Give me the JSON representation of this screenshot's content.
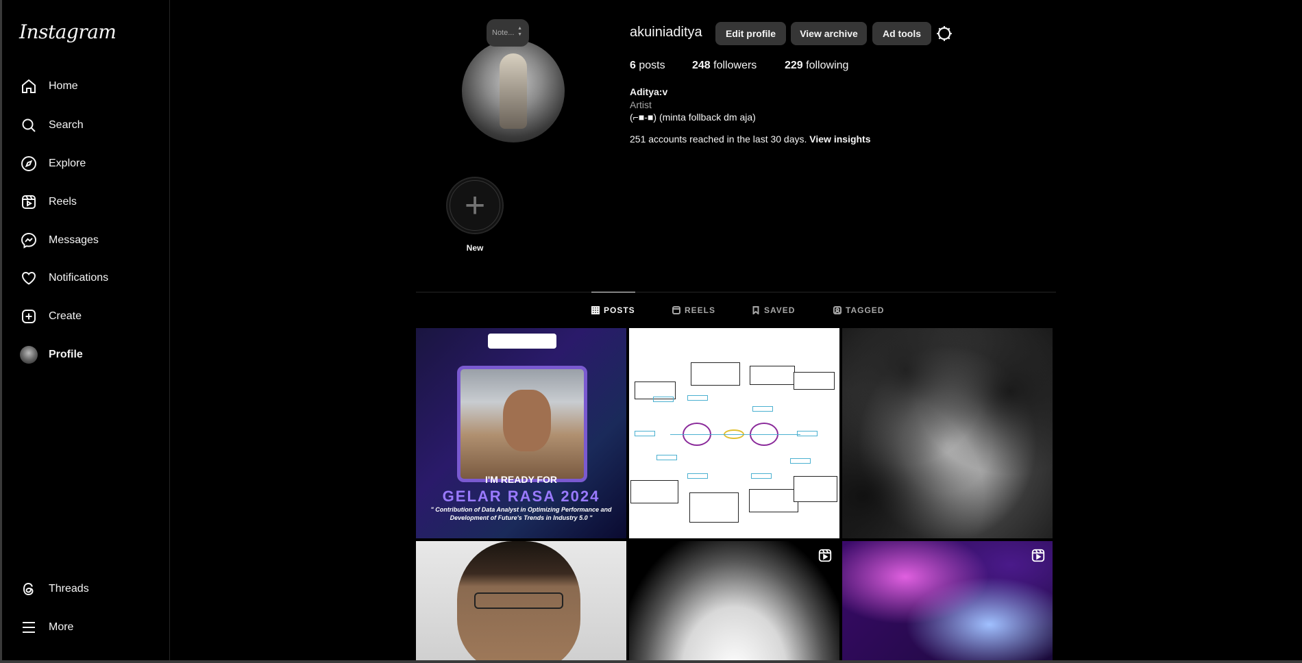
{
  "sidebar": {
    "logo": "Instagram",
    "items": [
      {
        "label": "Home"
      },
      {
        "label": "Search"
      },
      {
        "label": "Explore"
      },
      {
        "label": "Reels"
      },
      {
        "label": "Messages"
      },
      {
        "label": "Notifications"
      },
      {
        "label": "Create"
      },
      {
        "label": "Profile"
      }
    ],
    "bottom": [
      {
        "label": "Threads"
      },
      {
        "label": "More"
      }
    ]
  },
  "profile": {
    "note_placeholder": "Note...",
    "username": "akuiniaditya",
    "buttons": {
      "edit": "Edit profile",
      "archive": "View archive",
      "ads": "Ad tools"
    },
    "stats": {
      "posts_count": "6",
      "posts_label": "posts",
      "followers_count": "248",
      "followers_label": "followers",
      "following_count": "229",
      "following_label": "following"
    },
    "bio": {
      "name": "Aditya:v",
      "category": "Artist",
      "text": "(⌐■-■) (minta follback dm aja)"
    },
    "insights": {
      "text": "251 accounts reached in the last 30 days.",
      "link": "View insights"
    },
    "new_story_label": "New"
  },
  "tabs": [
    {
      "label": "POSTS",
      "active": true
    },
    {
      "label": "REELS",
      "active": false
    },
    {
      "label": "SAVED",
      "active": false
    },
    {
      "label": "TAGGED",
      "active": false
    }
  ],
  "posts": {
    "p1": {
      "line1": "I'M READY FOR",
      "line2": "GELAR RASA 2024",
      "line3": "\" Contribution of Data Analyst in Optimizing Performance and Development of Future's Trends in Industry 5.0 \""
    }
  }
}
